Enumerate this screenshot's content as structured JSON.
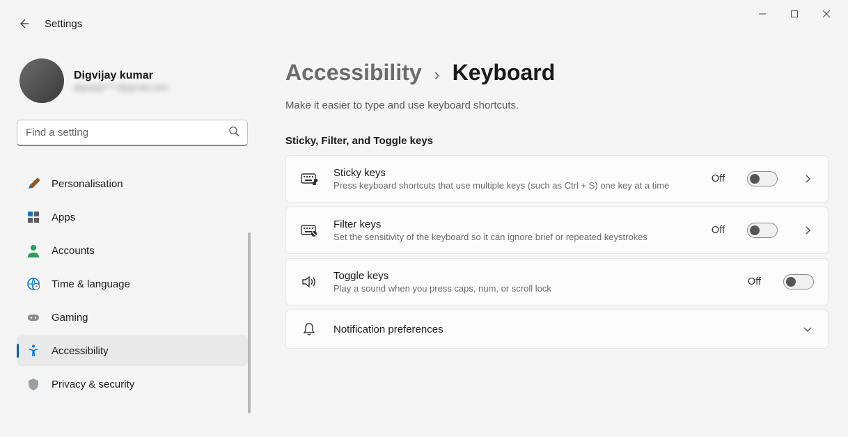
{
  "app_title": "Settings",
  "user": {
    "name": "Digvijay kumar",
    "email": "digvijay****@gmail.com"
  },
  "search": {
    "placeholder": "Find a setting"
  },
  "sidebar": {
    "items": [
      {
        "id": "personalisation",
        "label": "Personalisation"
      },
      {
        "id": "apps",
        "label": "Apps"
      },
      {
        "id": "accounts",
        "label": "Accounts"
      },
      {
        "id": "time-language",
        "label": "Time & language"
      },
      {
        "id": "gaming",
        "label": "Gaming"
      },
      {
        "id": "accessibility",
        "label": "Accessibility",
        "active": true
      },
      {
        "id": "privacy",
        "label": "Privacy & security"
      }
    ]
  },
  "breadcrumb": {
    "parent": "Accessibility",
    "separator": "›",
    "current": "Keyboard"
  },
  "subtitle": "Make it easier to type and use keyboard shortcuts.",
  "section_label": "Sticky, Filter, and Toggle keys",
  "settings": [
    {
      "id": "sticky-keys",
      "title": "Sticky keys",
      "desc": "Press keyboard shortcuts that use multiple keys (such as Ctrl + S) one key at a time",
      "state_label": "Off",
      "has_chevron": true
    },
    {
      "id": "filter-keys",
      "title": "Filter keys",
      "desc": "Set the sensitivity of the keyboard so it can ignore brief or repeated keystrokes",
      "state_label": "Off",
      "has_chevron": true
    },
    {
      "id": "toggle-keys",
      "title": "Toggle keys",
      "desc": "Play a sound when you press caps, num, or scroll lock",
      "state_label": "Off",
      "has_chevron": false
    }
  ],
  "notification_pref": {
    "title": "Notification preferences"
  }
}
